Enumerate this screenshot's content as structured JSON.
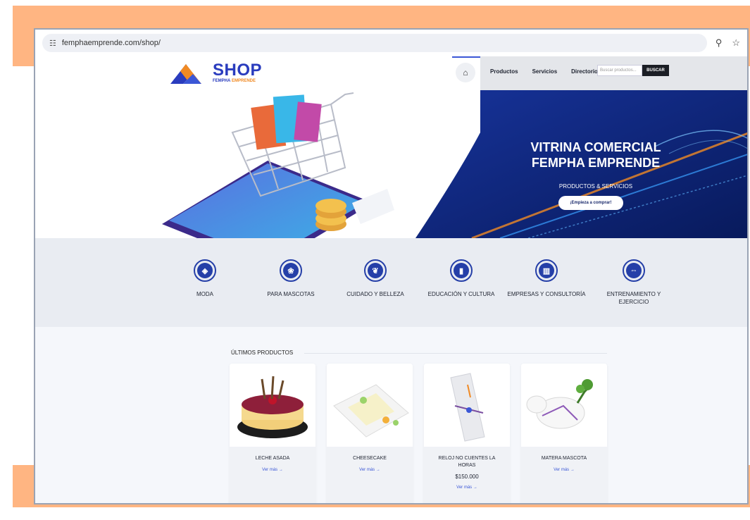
{
  "browser": {
    "url": "femphaemprende.com/shop/",
    "icons": [
      "tune-icon",
      "zoom-icon",
      "star-icon"
    ]
  },
  "header": {
    "logo_main": "SHOP",
    "logo_sub_a": "FEMPHA",
    "logo_sub_b": "EMPRENDE",
    "home_icon": "⌂",
    "nav": [
      "Productos",
      "Servicios",
      "Directorio"
    ],
    "search_placeholder": "Buscar productos...",
    "search_button": "BUSCAR"
  },
  "hero": {
    "title_line1": "VITRINA COMERCIAL",
    "title_line2": "FEMPHA EMPRENDE",
    "subtitle": "PRODUCTOS & SERVICIOS",
    "cta": "¡Empieza a comprar!"
  },
  "categories": [
    {
      "label": "MODA",
      "icon": "tag-icon"
    },
    {
      "label": "PARA MASCOTAS",
      "icon": "paw-icon"
    },
    {
      "label": "CUIDADO Y BELLEZA",
      "icon": "leaf-icon"
    },
    {
      "label": "EDUCACIÓN Y CULTURA",
      "icon": "book-icon"
    },
    {
      "label": "EMPRESAS Y CONSULTORÍA",
      "icon": "chart-icon"
    },
    {
      "label": "ENTRENAMIENTO Y EJERCICIO",
      "icon": "dumbbell-icon"
    }
  ],
  "products": {
    "section_title": "ÚLTIMOS PRODUCTOS",
    "items": [
      {
        "name": "LECHE ASADA",
        "price": "",
        "more": "Ver más →"
      },
      {
        "name": "CHEESECAKE",
        "price": "",
        "more": "Ver más →"
      },
      {
        "name": "RELOJ NO CUENTES LA HORAS",
        "price": "$150.000",
        "more": "Ver más →"
      },
      {
        "name": "MATERA MASCOTA",
        "price": "",
        "more": "Ver más →"
      }
    ]
  },
  "colors": {
    "frame": "#FFB582",
    "brand_blue": "#2a3cbe",
    "hero_navy": "#0d2370",
    "accent_orange": "#f08a24"
  }
}
